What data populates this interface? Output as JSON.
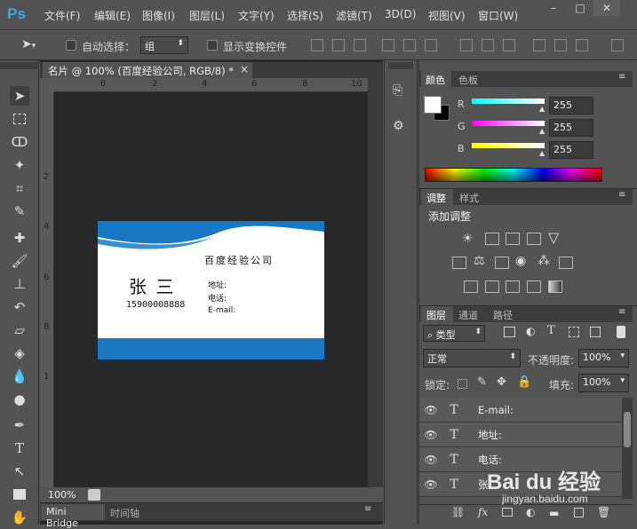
{
  "menubar": {
    "logo": "Ps",
    "items": [
      "文件(F)",
      "编辑(E)",
      "图像(I)",
      "图层(L)",
      "文字(Y)",
      "选择(S)",
      "滤镜(T)",
      "3D(D)",
      "视图(V)",
      "窗口(W)"
    ],
    "minimize": "–",
    "restore": "□",
    "close": "✕"
  },
  "options": {
    "auto_select_label": "自动选择：",
    "group_value": "组",
    "show_transform_label": "显示变换控件"
  },
  "document": {
    "tab_title": "名片 @ 100% (百度经验公司, RGB/8) *",
    "tab_close": "×",
    "zoom": "100%",
    "ruler_h": [
      "0",
      "2",
      "4",
      "6",
      "8",
      "10"
    ],
    "ruler_v": [
      "2",
      "4",
      "6",
      "8",
      "1"
    ]
  },
  "card": {
    "company": "百度经验公司",
    "name": "张 三",
    "phone": "15900008888",
    "address_label": "地址:",
    "tel_label": "电话:",
    "email_label": "E-mail:",
    "colors": {
      "blue": "#1a78c2",
      "lightblue": "#3a8fd1"
    }
  },
  "bottom_tabs": {
    "mini_bridge": "Mini Bridge",
    "timeline": "时间轴"
  },
  "color_panel": {
    "tabs": [
      "颜色",
      "色板"
    ],
    "r_label": "R",
    "g_label": "G",
    "b_label": "B",
    "r_value": "255",
    "g_value": "255",
    "b_value": "255"
  },
  "adjust_panel": {
    "tabs": [
      "调整",
      "样式"
    ],
    "add_label": "添加调整"
  },
  "layers_panel": {
    "tabs": [
      "图层",
      "通道",
      "路径"
    ],
    "filter_kind": "类型",
    "blend_mode": "正常",
    "opacity_label": "不透明度:",
    "opacity_value": "100%",
    "lock_label": "锁定:",
    "fill_label": "填充:",
    "fill_value": "100%",
    "layers": [
      "E-mail:",
      "地址:",
      "电话:",
      "张"
    ],
    "fx_label": "fx"
  },
  "watermark": {
    "text": "Bai du 经验",
    "url": "jingyan.baidu.com"
  }
}
